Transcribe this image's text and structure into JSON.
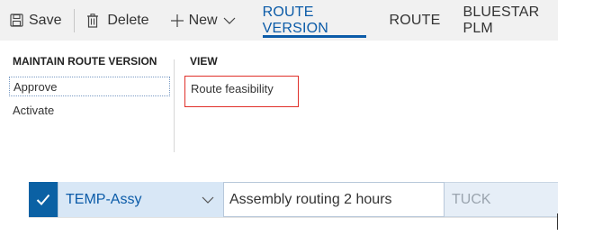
{
  "toolbar": {
    "save_label": "Save",
    "delete_label": "Delete",
    "new_label": "New",
    "tabs": [
      {
        "label": "ROUTE VERSION",
        "active": true
      },
      {
        "label": "ROUTE",
        "active": false
      },
      {
        "label": "BLUESTAR PLM",
        "active": false
      }
    ],
    "icons": {
      "save": "save-icon",
      "delete": "trash-icon",
      "new": "plus-icon",
      "dropdown": "chevron-down-icon"
    },
    "accent_color": "#0b5ba8"
  },
  "action_pane": {
    "maintain_group": {
      "title": "MAINTAIN ROUTE VERSION",
      "items": [
        "Approve",
        "Activate"
      ]
    },
    "view_group": {
      "title": "VIEW",
      "items": [
        "Route feasibility"
      ],
      "highlight_color": "#e0302a"
    }
  },
  "grid": {
    "row": {
      "selected": true,
      "route": "TEMP-Assy",
      "name": "Assembly routing 2 hours",
      "third": "TUCK"
    },
    "selection_color": "#0b61a4"
  }
}
